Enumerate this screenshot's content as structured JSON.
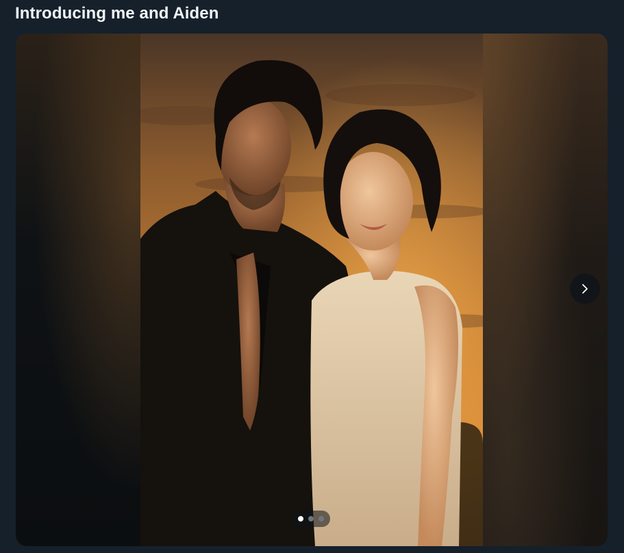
{
  "post": {
    "title": "Introducing me and Aiden"
  },
  "carousel": {
    "current_index": 1,
    "total": 3,
    "next_icon": "chevron-right-icon",
    "image_alt": "Painted portrait of a dark-haired man in a black open shirt beside a smiling short-haired woman in a white sundress against a sunset sky"
  },
  "colors": {
    "background": "#15202b",
    "title": "#f1f4f6",
    "dot_active": "#ffffff",
    "dot_inactive": "#6e767d"
  }
}
